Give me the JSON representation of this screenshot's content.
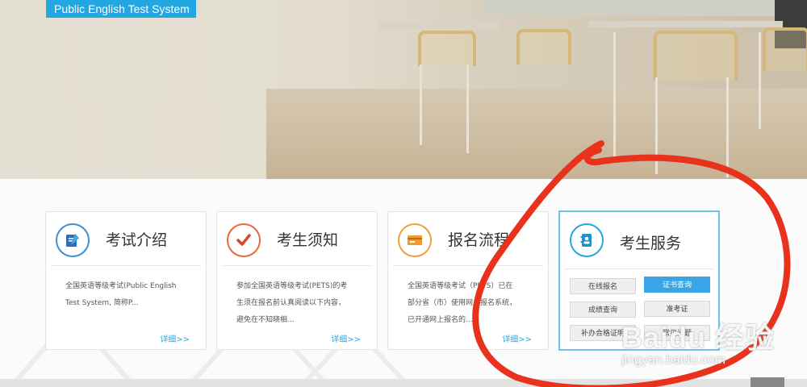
{
  "header": {
    "badge_text": "Public English Test System"
  },
  "cards": [
    {
      "title": "考试介绍",
      "icon": "exam-intro-icon",
      "desc_lines": [
        "全国英语等级考试(Public English",
        "Test System, 简称P..."
      ],
      "more": "详细>>"
    },
    {
      "title": "考生须知",
      "icon": "checkmark-icon",
      "desc_lines": [
        "参加全国英语等级考试(PETS)的考",
        "生须在报名前认真阅读以下内容，",
        "避免在不知晓相..."
      ],
      "more": "详细>>"
    },
    {
      "title": "报名流程",
      "icon": "registration-card-icon",
      "desc_lines": [
        "全国英语等级考试（PETS）已在",
        "部分省（市）使用网上报名系统，",
        "已开通网上报名的..."
      ],
      "more": "详细>>"
    }
  ],
  "service": {
    "title": "考生服务",
    "icon": "contact-book-icon",
    "buttons": [
      {
        "label": "在线报名",
        "primary": false
      },
      {
        "label": "证书查询",
        "primary": true
      },
      {
        "label": "成绩查询",
        "primary": false
      },
      {
        "label": "准考证",
        "primary": false
      },
      {
        "label": "补办合格证明",
        "primary": false
      },
      {
        "label": "常见问题",
        "primary": false
      }
    ]
  },
  "watermark": {
    "line1": "Baidu 经验",
    "line2": "jingyan.baidu.com"
  },
  "colors": {
    "accent": "#22a7e0",
    "annotation": "#e8321c"
  }
}
